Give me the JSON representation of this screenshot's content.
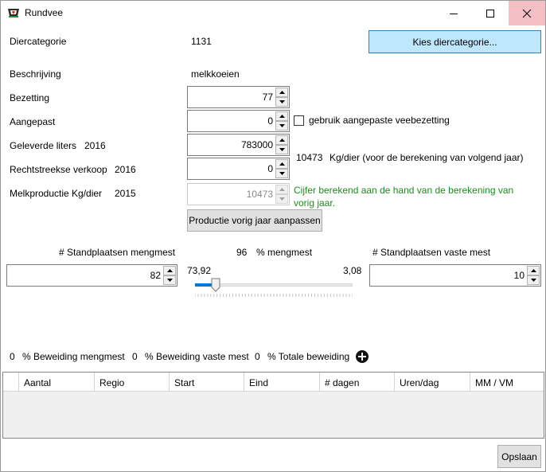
{
  "window": {
    "title": "Rundvee"
  },
  "form": {
    "diercategorie_label": "Diercategorie",
    "diercategorie_value": "1131",
    "kies_button": "Kies diercategorie...",
    "beschrijving_label": "Beschrijving",
    "beschrijving_value": "melkkoeien",
    "bezetting_label": "Bezetting",
    "bezetting_value": "77",
    "aangepast_label": "Aangepast",
    "aangepast_value": "0",
    "gebruik_checkbox_label": "gebruik aangepaste veebezetting",
    "geleverde_label": "Geleverde liters",
    "geleverde_year": "2016",
    "geleverde_value": "783000",
    "kg_per_dier_value": "10473",
    "kg_per_dier_text": "Kg/dier (voor de berekening van volgend jaar)",
    "rechtstreekse_label": "Rechtstreekse verkoop",
    "rechtstreekse_year": "2016",
    "rechtstreekse_value": "0",
    "melkproductie_label": "Melkproductie Kg/dier",
    "melkproductie_year": "2015",
    "melkproductie_value": "10473",
    "cijfer_note_line1": "Cijfer berekend aan de hand van de berekening van",
    "cijfer_note_line2": "vorig jaar.",
    "productie_button": "Productie vorig jaar aanpassen"
  },
  "stalling": {
    "mengmest_label": "# Standplaatsen mengmest",
    "mengmest_value": "82",
    "percent_value": "96",
    "percent_label": "% mengmest",
    "vaste_label": "# Standplaatsen vaste mest",
    "vaste_value": "10",
    "slider_left_value": "73,92",
    "slider_right_value": "3,08",
    "slider_level": 0.13
  },
  "beweiding": {
    "mengmest_value": "0",
    "mengmest_label": "% Beweiding mengmest",
    "vaste_value": "0",
    "vaste_label": "% Beweiding vaste mest",
    "totale_value": "0",
    "totale_label": "% Totale beweiding"
  },
  "grid": {
    "columns": [
      "Aantal",
      "Regio",
      "Start",
      "Eind",
      "# dagen",
      "Uren/dag",
      "MM / VM"
    ]
  },
  "footer": {
    "save_button": "Opslaan"
  }
}
